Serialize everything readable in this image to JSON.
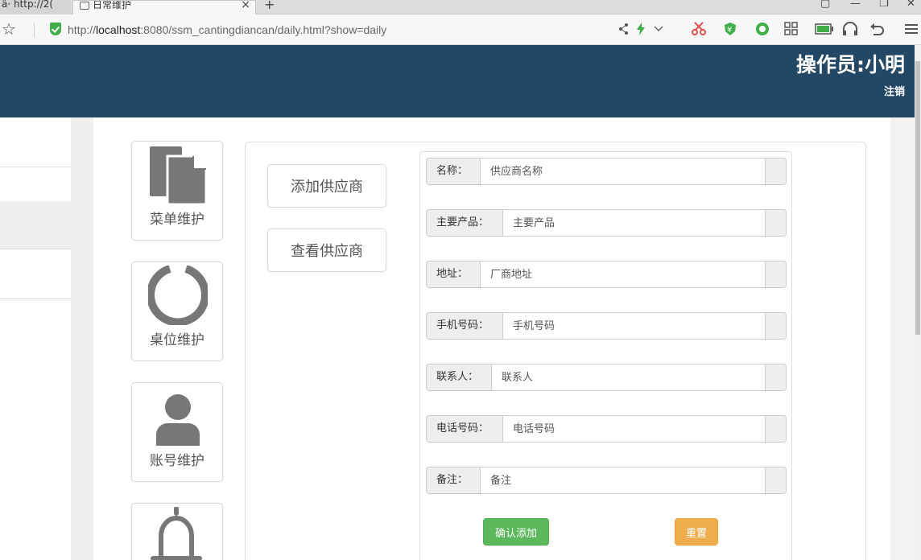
{
  "browser": {
    "tabs": [
      {
        "label": "ä· http://2("
      },
      {
        "label": "日常维护"
      }
    ],
    "tab_close": "×",
    "new_tab": "+",
    "url_prefix": "http://",
    "url_host": "localhost",
    "url_rest": ":8080/ssm_cantingdiancan/daily.html?show=daily",
    "star_glyph": "☆",
    "window_controls": [
      "▢",
      "—",
      "❐",
      "✕"
    ]
  },
  "header": {
    "operator": "操作员:小明",
    "logout": "注销",
    "background": "#234866"
  },
  "sidebar": {
    "items": [
      {
        "label": "菜单维护",
        "icon": "document-icon"
      },
      {
        "label": "桌位维护",
        "icon": "ring-icon"
      },
      {
        "label": "账号维护",
        "icon": "user-icon"
      },
      {
        "label": "",
        "icon": "bell-icon"
      }
    ]
  },
  "actions": {
    "add_supplier": "添加供应商",
    "view_supplier": "查看供应商"
  },
  "form": {
    "fields": [
      {
        "label": "名称：",
        "placeholder": "供应商名称"
      },
      {
        "label": "主要产品：",
        "placeholder": "主要产品"
      },
      {
        "label": "地址：",
        "placeholder": "厂商地址"
      },
      {
        "label": "手机号码：",
        "placeholder": "手机号码"
      },
      {
        "label": "联系人：",
        "placeholder": "联系人"
      },
      {
        "label": "电话号码：",
        "placeholder": "电话号码"
      },
      {
        "label": "备注：",
        "placeholder": "备注"
      }
    ],
    "confirm": "确认添加",
    "reset": "重置"
  },
  "colors": {
    "confirm": "#5cb85c",
    "reset": "#f0ad4e",
    "icon_gray": "#777777"
  }
}
